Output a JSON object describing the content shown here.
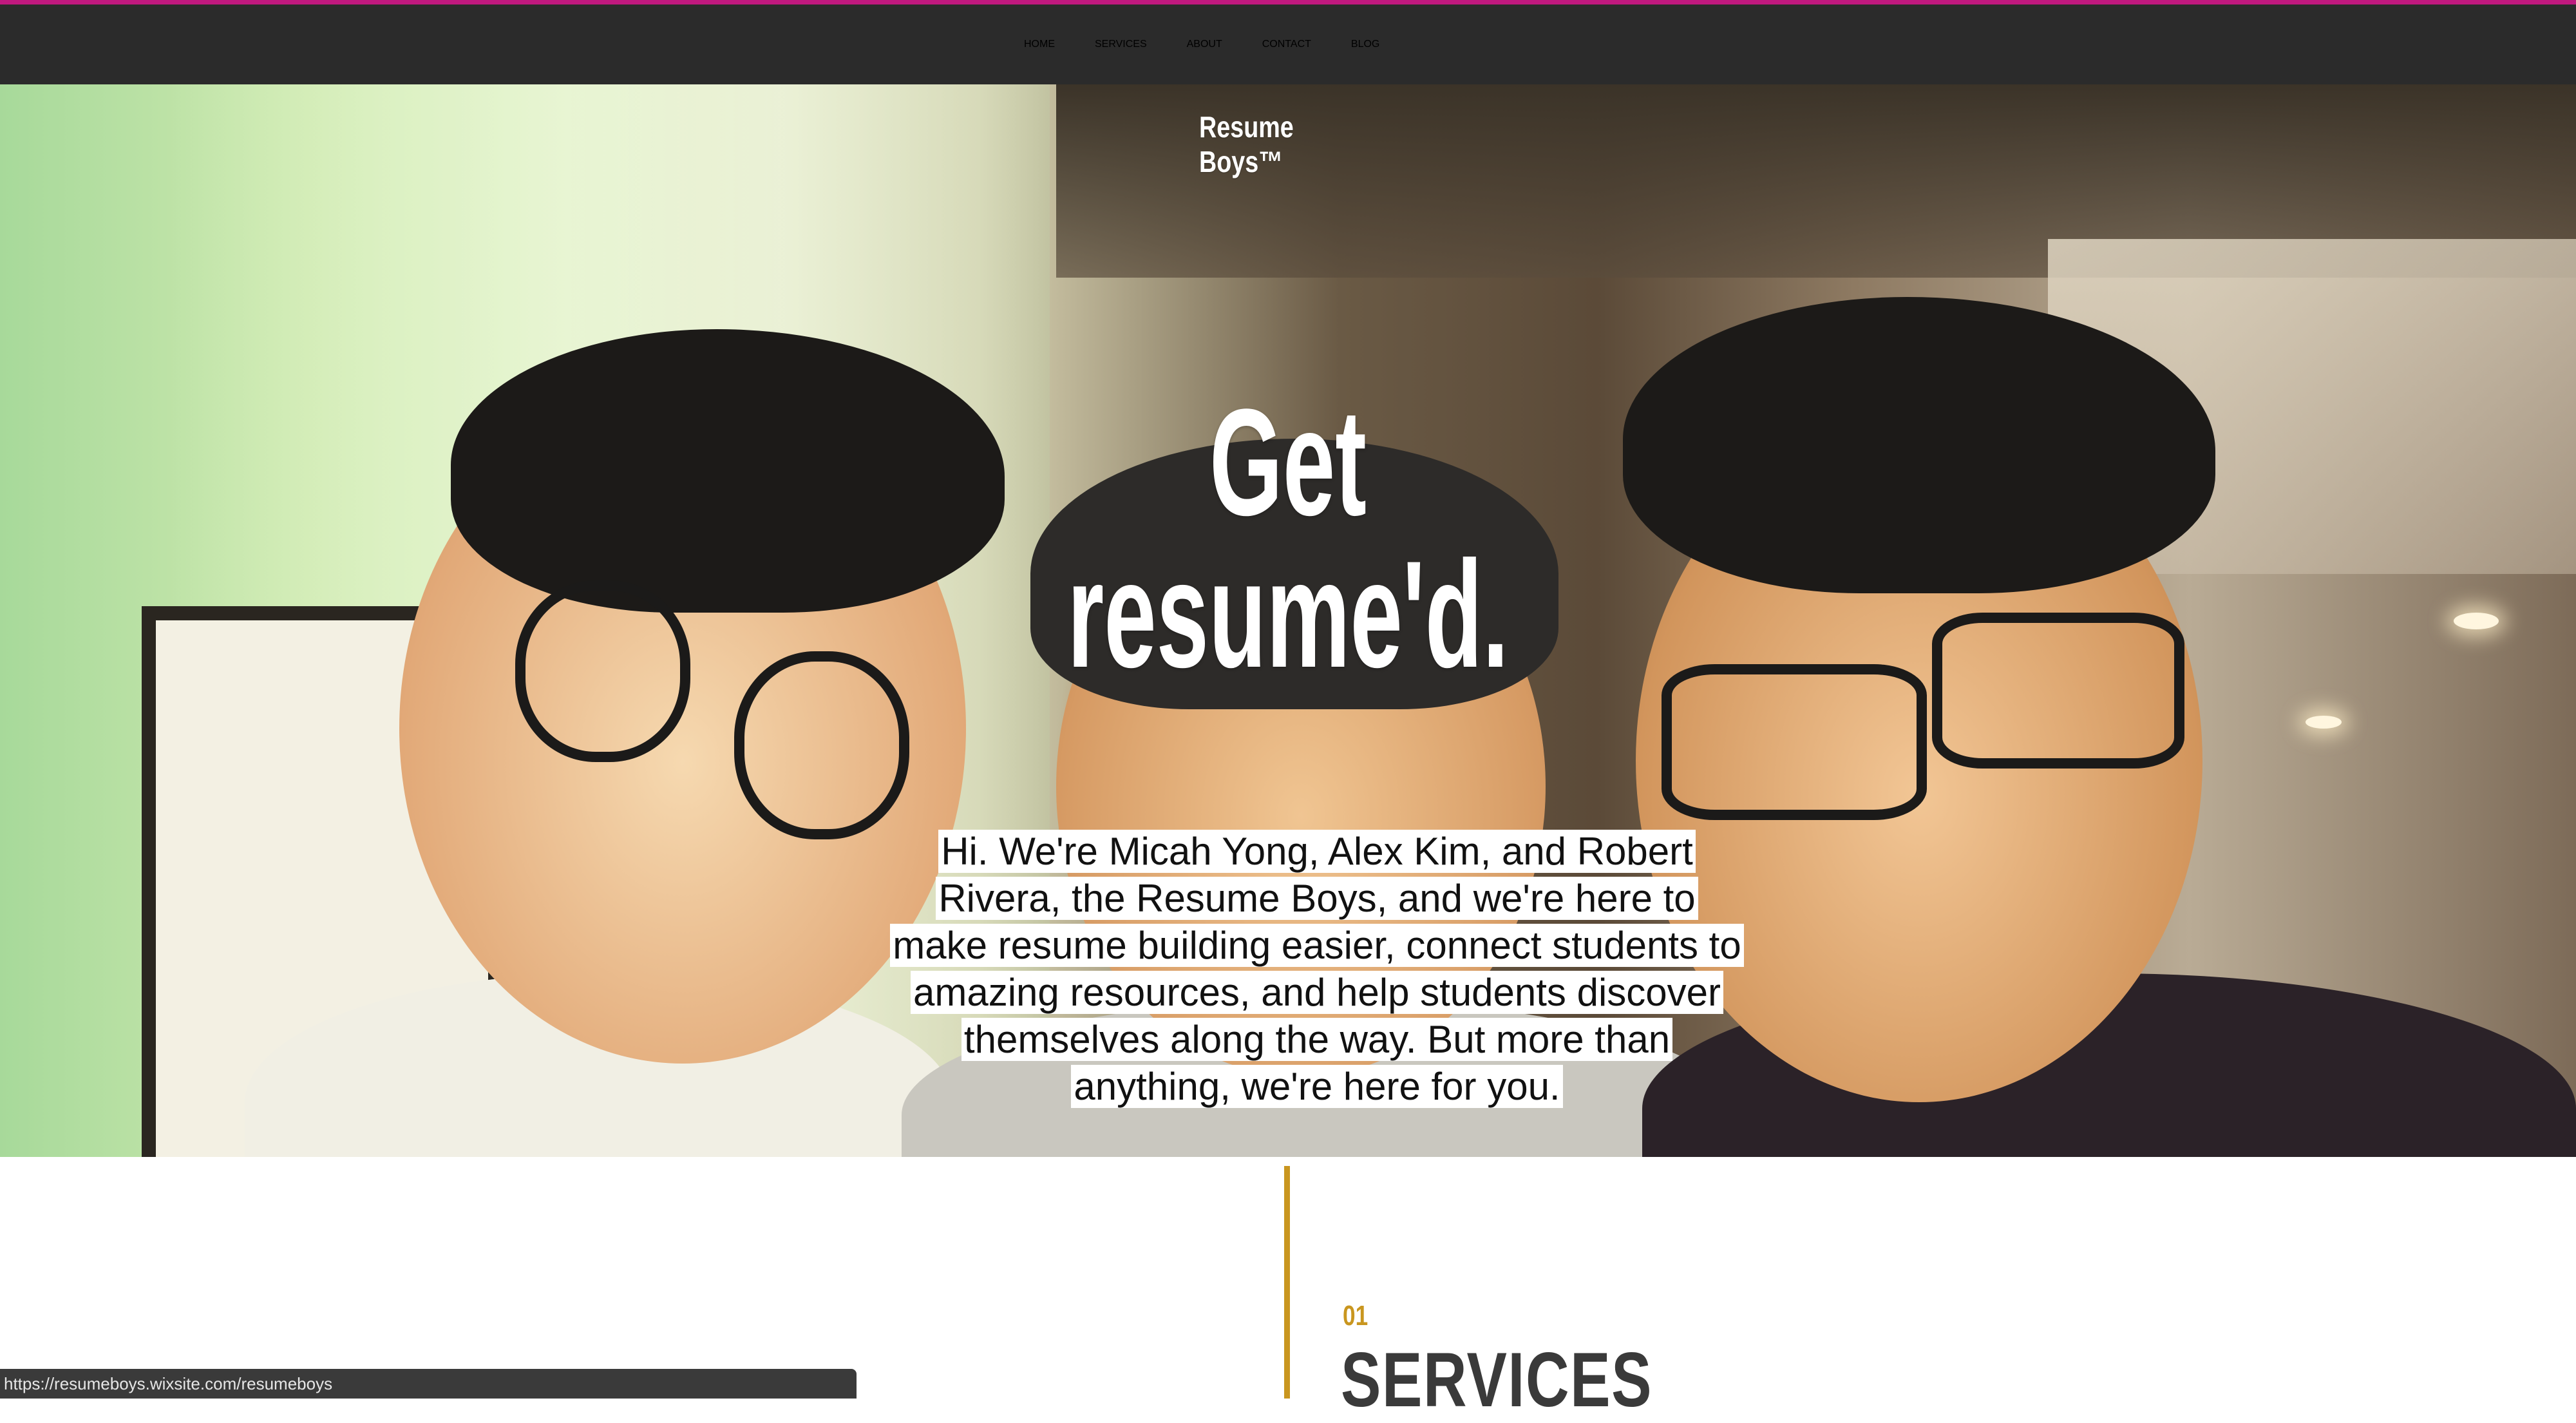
{
  "nav": {
    "items": [
      {
        "label": "HOME",
        "active": true
      },
      {
        "label": "SERVICES",
        "active": false
      },
      {
        "label": "ABOUT",
        "active": false
      },
      {
        "label": "CONTACT",
        "active": false
      },
      {
        "label": "BLOG",
        "active": false
      }
    ],
    "active_color": "#d8a53b",
    "bar_color": "#2b2b2b",
    "accent_line_color": "#c0197e"
  },
  "hero": {
    "brand": "Resume Boys™",
    "headline": "Get resume'd.",
    "intro": "Hi. We're Micah Yong, Alex Kim, and Robert Rivera, the Resume Boys, and we're here to make resume building easier, connect students to amazing resources, and help students discover themselves along the way. But more than anything, we're here for you."
  },
  "section": {
    "number": "01",
    "title": "SERVICES",
    "accent_color": "#c9961f"
  },
  "status_bar": {
    "url": "https://resumeboys.wixsite.com/resumeboys"
  }
}
